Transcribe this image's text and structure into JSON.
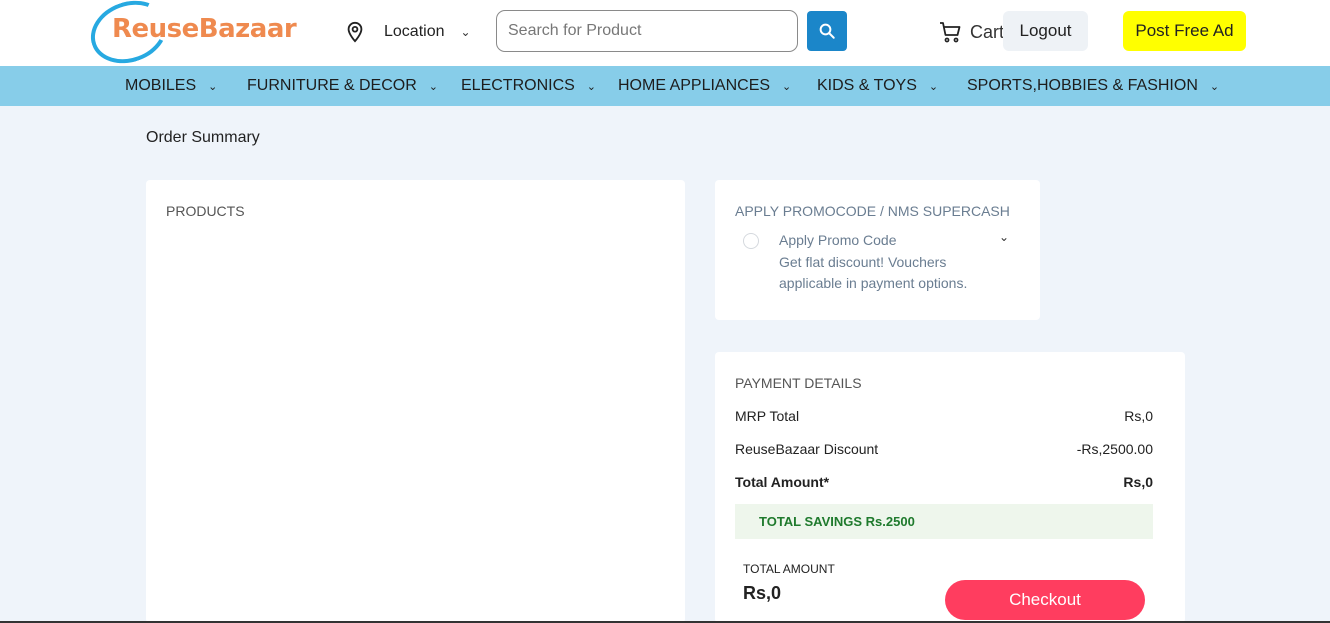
{
  "header": {
    "logo_text": "ReuseBazaar",
    "location_label": "Location",
    "search_placeholder": "Search for Product",
    "cart_label": "Cart",
    "logout_label": "Logout",
    "post_ad_label": "Post Free Ad"
  },
  "nav": {
    "items": [
      {
        "label": "MOBILES"
      },
      {
        "label": "FURNITURE & DECOR"
      },
      {
        "label": "ELECTRONICS"
      },
      {
        "label": "HOME APPLIANCES"
      },
      {
        "label": "KIDS & TOYS"
      },
      {
        "label": "SPORTS,HOBBIES & FASHION"
      }
    ]
  },
  "page": {
    "title": "Order Summary"
  },
  "products": {
    "heading": "PRODUCTS"
  },
  "promo": {
    "heading": "APPLY PROMOCODE / NMS SUPERCASH",
    "option_title": "Apply Promo Code",
    "option_desc": "Get flat discount! Vouchers applicable in payment options."
  },
  "payment": {
    "heading": "PAYMENT DETAILS",
    "rows": [
      {
        "label": "MRP Total",
        "value": "Rs,0"
      },
      {
        "label": "ReuseBazaar Discount",
        "value": "-Rs,2500.00"
      },
      {
        "label": "Total Amount*",
        "value": "Rs,0"
      }
    ],
    "savings": "TOTAL SAVINGS Rs.2500",
    "total_label": "TOTAL AMOUNT",
    "total_value": "Rs,0",
    "checkout_label": "Checkout"
  },
  "colors": {
    "nav_bg": "#87cde9",
    "page_bg": "#eff4fa",
    "search_button": "#1b86c9",
    "post_ad": "#ffff00",
    "checkout": "#ff3d5f",
    "logo_orange": "#ef8a4f",
    "logo_blue": "#27a9e1",
    "savings_green": "#1f7a2d"
  }
}
